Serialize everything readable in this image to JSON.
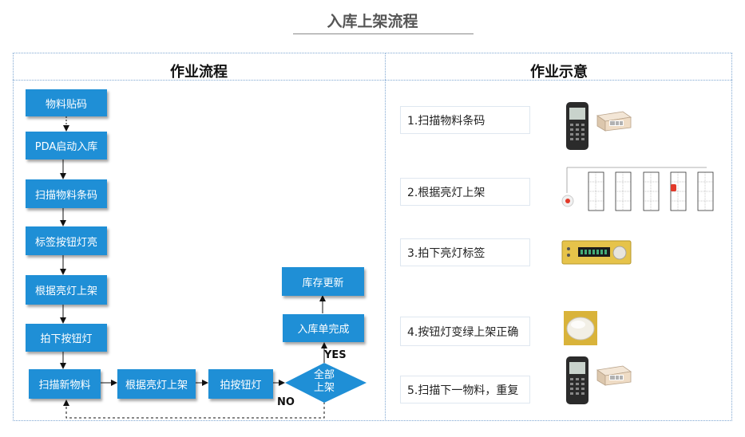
{
  "title": "入库上架流程",
  "left_header": "作业流程",
  "right_header": "作业示意",
  "flow": {
    "steps": [
      "物料贴码",
      "PDA启动入库",
      "扫描物料条码",
      "标签按钮灯亮",
      "根据亮灯上架",
      "拍下按钮灯"
    ],
    "bottom": [
      "扫描新物料",
      "根据亮灯上架",
      "拍按钮灯"
    ],
    "decision_line1": "全部",
    "decision_line2": "上架",
    "yes_label": "YES",
    "no_label": "NO",
    "complete": "入库单完成",
    "stock_update": "库存更新"
  },
  "illustration": {
    "steps": [
      "1.扫描物料条码",
      "2.根据亮灯上架",
      "3.拍下亮灯标签",
      "4.按钮灯变绿上架正确",
      "5.扫描下一物料，重复"
    ]
  }
}
